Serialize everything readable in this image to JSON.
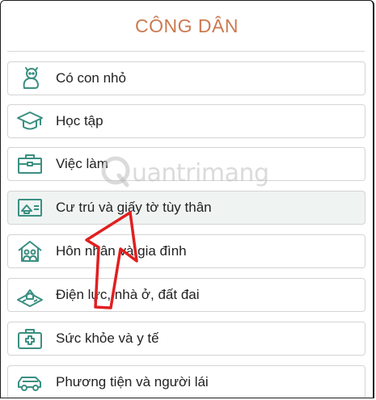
{
  "header": {
    "title": "CÔNG DÂN"
  },
  "items": [
    {
      "label": "Có con nhỏ"
    },
    {
      "label": "Học tập"
    },
    {
      "label": "Việc làm"
    },
    {
      "label": "Cư trú và giấy tờ tùy thân"
    },
    {
      "label": "Hôn nhân và gia đình"
    },
    {
      "label": "Điện lực, nhà ở, đất đai"
    },
    {
      "label": "Sức khỏe và y tế"
    },
    {
      "label": "Phương tiện và người lái"
    }
  ],
  "watermark": {
    "text": "uantrimang"
  },
  "colors": {
    "title": "#cc7a50",
    "icon": "#3b8f82",
    "arrow": "#e02020",
    "active_bg": "#eff4f3"
  }
}
